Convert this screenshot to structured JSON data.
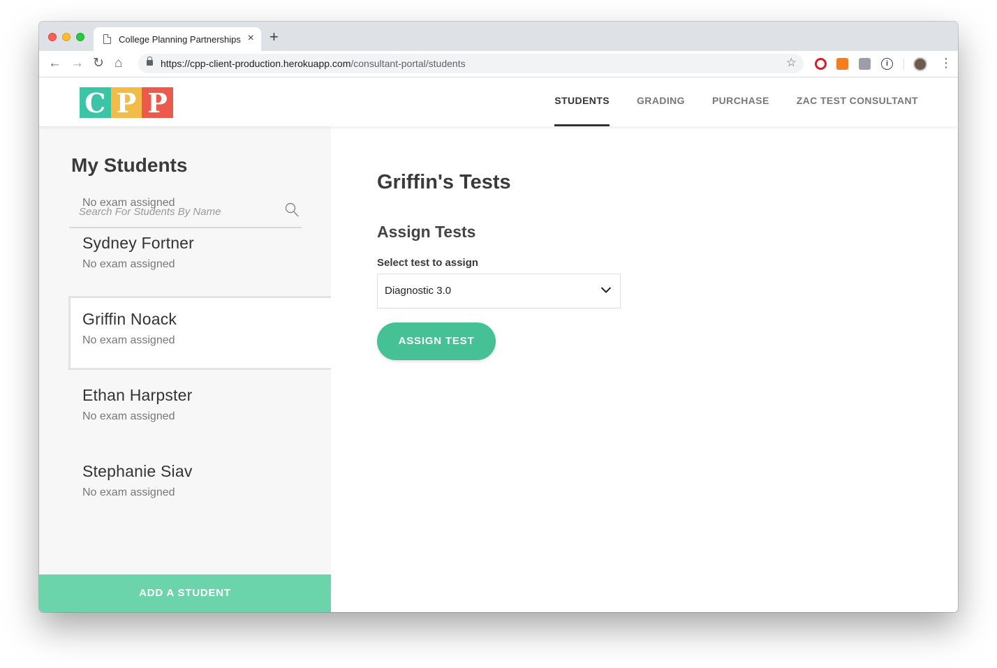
{
  "browser": {
    "tab_title": "College Planning Partnerships",
    "tab_close": "×",
    "new_tab": "+",
    "url_host": "https://cpp-client-production.herokuapp.com",
    "url_path": "/consultant-portal/students",
    "nav_icons": [
      "back-icon",
      "forward-icon",
      "reload-icon",
      "home-icon"
    ],
    "extension_icons": [
      "opera-icon",
      "chart-extension-icon",
      "puzzle-extension-icon",
      "info-extension-icon"
    ]
  },
  "header": {
    "logo_letters": [
      "C",
      "P",
      "P"
    ],
    "nav": [
      {
        "label": "STUDENTS",
        "active": true
      },
      {
        "label": "GRADING",
        "active": false
      },
      {
        "label": "PURCHASE",
        "active": false
      },
      {
        "label": "ZAC TEST CONSULTANT",
        "active": false
      }
    ]
  },
  "sidebar": {
    "title": "My Students",
    "search_placeholder": "Search For Students By Name",
    "partial_status": "No exam assigned",
    "students": [
      {
        "name": "Sydney Fortner",
        "status": "No exam assigned"
      },
      {
        "name": "Griffin Noack",
        "status": "No exam assigned",
        "selected": true
      },
      {
        "name": "Ethan Harpster",
        "status": "No exam assigned"
      },
      {
        "name": "Stephanie Siav",
        "status": "No exam assigned"
      }
    ],
    "add_button": "ADD A STUDENT"
  },
  "main": {
    "title": "Griffin's Tests",
    "section_title": "Assign Tests",
    "select_label": "Select test to assign",
    "selected_test": "Diagnostic 3.0",
    "assign_button": "ASSIGN TEST"
  },
  "colors": {
    "accent": "#45c195",
    "add_button": "#6bd4aa",
    "logo_c": "#3cc4a6",
    "logo_p1": "#f3bb47",
    "logo_p2": "#ec5a4c"
  }
}
